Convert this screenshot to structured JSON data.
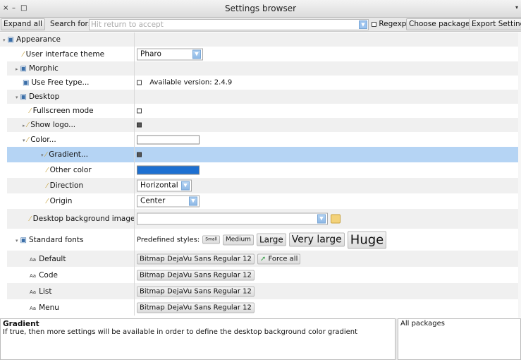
{
  "window": {
    "title": "Settings browser",
    "close_glyph": "×",
    "minimize_glyph": "–",
    "maximize_glyph": "□",
    "menu_glyph": "▾"
  },
  "toolbar": {
    "expand_all": "Expand all",
    "search_label": "Search for:",
    "search_placeholder": "Hit return to accept",
    "search_value": "",
    "regexp_label": "Regexp",
    "regexp_checked": false,
    "choose_packages": "Choose packages",
    "export_settings": "Export Settings"
  },
  "tree": {
    "rows": [
      {
        "label": "Appearance",
        "icon": "package-icon",
        "expander": "▾"
      },
      {
        "label": "User interface theme",
        "icon": "brush-icon",
        "value": "Pharo"
      },
      {
        "label": "Morphic",
        "icon": "package-icon",
        "expander": "▸"
      },
      {
        "label": "Use Free type...",
        "icon": "package-icon",
        "value": "Available version: 2.4.9",
        "checked": false
      },
      {
        "label": "Desktop",
        "icon": "package-icon",
        "expander": "▾"
      },
      {
        "label": "Fullscreen mode",
        "icon": "brush-icon",
        "checked": false
      },
      {
        "label": "Show logo...",
        "icon": "brush-icon",
        "expander": "▸",
        "checked": true
      },
      {
        "label": "Color...",
        "icon": "brush-icon",
        "expander": "▾",
        "color": "#ffffff"
      },
      {
        "label": "Gradient...",
        "icon": "brush-icon",
        "expander": "▾",
        "checked": true,
        "selected": true
      },
      {
        "label": "Other color",
        "icon": "brush-icon",
        "color": "#1c6fd1"
      },
      {
        "label": "Direction",
        "icon": "brush-icon",
        "value": "Horizontal"
      },
      {
        "label": "Origin",
        "icon": "brush-icon",
        "value": "Center"
      },
      {
        "label": "Desktop background image",
        "icon": "brush-icon",
        "value": ""
      },
      {
        "label": "Standard fonts",
        "icon": "package-icon",
        "expander": "▾",
        "predefined_label": "Predefined styles:",
        "styles": [
          "Small",
          "Medium",
          "Large",
          "Very large",
          "Huge"
        ]
      },
      {
        "label": "Default",
        "icon": "font-icon",
        "value": "Bitmap DejaVu Sans Regular 12",
        "force_all": "Force all"
      },
      {
        "label": "Code",
        "icon": "font-icon",
        "value": "Bitmap DejaVu Sans Regular 12"
      },
      {
        "label": "List",
        "icon": "font-icon",
        "value": "Bitmap DejaVu Sans Regular 12"
      },
      {
        "label": "Menu",
        "icon": "font-icon",
        "value": "Bitmap DejaVu Sans Regular 12"
      }
    ],
    "font_icon_text": "Aa"
  },
  "description": {
    "title": "Gradient",
    "body": "If true, then more settings will be available in order to define the desktop background color gradient"
  },
  "packages": {
    "label": "All packages"
  },
  "colors": {
    "selection": "#b5d4f4",
    "accent": "#1c6fd1",
    "package_icon": "#3a6ea8",
    "brush_icon": "#c9a84a"
  }
}
